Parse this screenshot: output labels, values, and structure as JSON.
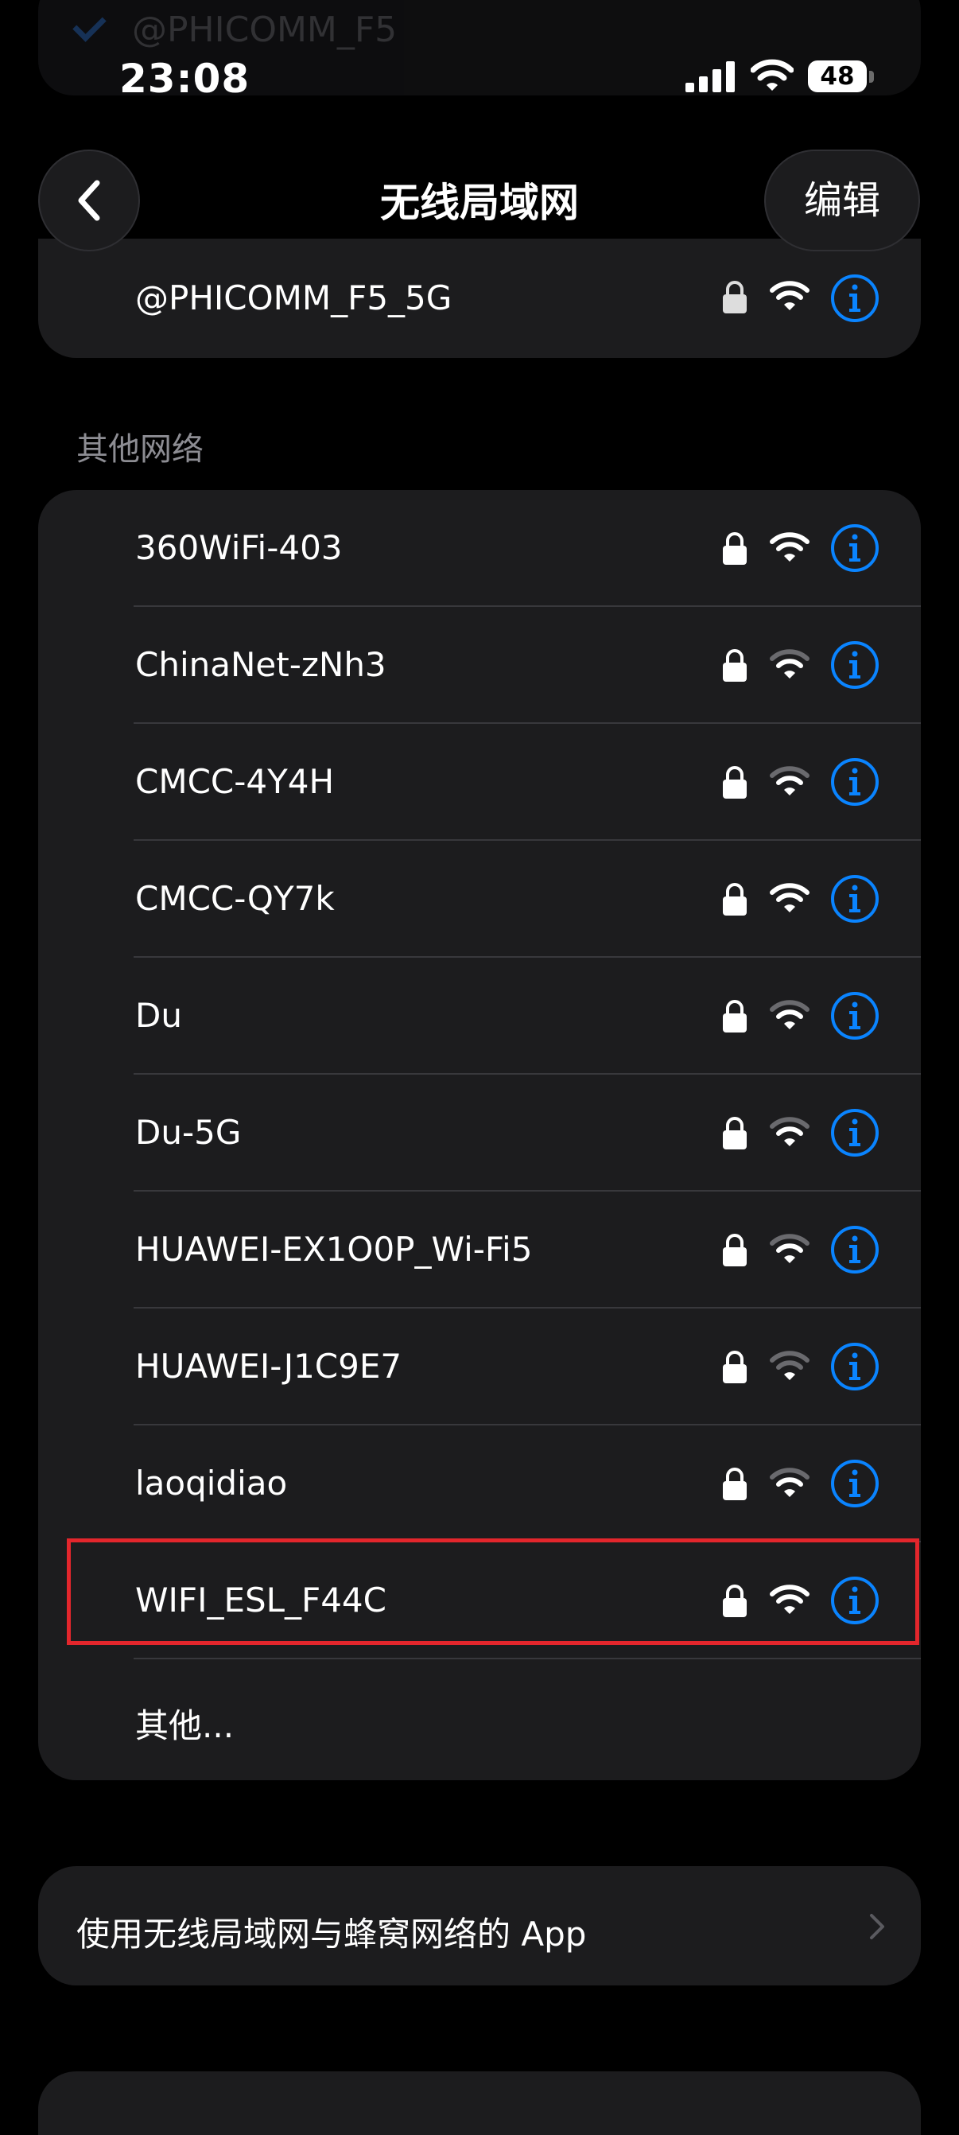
{
  "status_bar": {
    "time": "23:08",
    "battery": "48"
  },
  "ghost": {
    "text": "@PHICOMM_F5"
  },
  "nav": {
    "title": "无线局域网",
    "edit_label": "编辑"
  },
  "current_network": {
    "name": "@PHICOMM_F5_5G",
    "secured": true,
    "signal_bars": 3
  },
  "other_networks": {
    "header": "其他网络",
    "items": [
      {
        "name": "360WiFi-403",
        "secured": true,
        "signal_bars": 3
      },
      {
        "name": "ChinaNet-zNh3",
        "secured": true,
        "signal_bars": 2
      },
      {
        "name": "CMCC-4Y4H",
        "secured": true,
        "signal_bars": 2
      },
      {
        "name": "CMCC-QY7k",
        "secured": true,
        "signal_bars": 3
      },
      {
        "name": "Du",
        "secured": true,
        "signal_bars": 2
      },
      {
        "name": "Du-5G",
        "secured": true,
        "signal_bars": 2
      },
      {
        "name": "HUAWEI-EX1O0P_Wi-Fi5",
        "secured": true,
        "signal_bars": 2
      },
      {
        "name": "HUAWEI-J1C9E7",
        "secured": true,
        "signal_bars": 1
      },
      {
        "name": "laoqidiao",
        "secured": true,
        "signal_bars": 2
      },
      {
        "name": "WIFI_ESL_F44C",
        "secured": true,
        "signal_bars": 3
      }
    ],
    "other_label": "其他..."
  },
  "apps_row": {
    "label": "使用无线局域网与蜂窝网络的 App"
  },
  "colors": {
    "accent": "#0a84ff",
    "highlight": "#e3262c",
    "card": "#1c1c1e"
  }
}
